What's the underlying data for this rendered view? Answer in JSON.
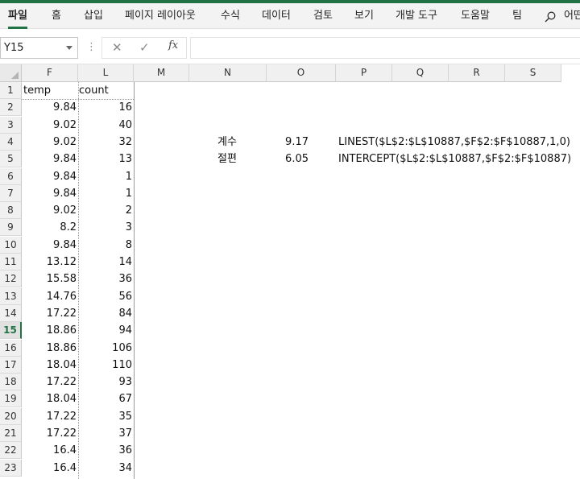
{
  "ribbon": {
    "tabs": [
      "파일",
      "홈",
      "삽입",
      "페이지 레이아웃",
      "수식",
      "데이터",
      "검토",
      "보기",
      "개발 도구",
      "도움말",
      "팀"
    ],
    "active_tab": "파일",
    "overflow_label": "어떤",
    "accent": "#217346"
  },
  "formula_bar": {
    "name_box": "Y15",
    "cancel_glyph": "✕",
    "enter_glyph": "✓",
    "fx_label": "fx",
    "formula": ""
  },
  "grid": {
    "columns": [
      "F",
      "L",
      "M",
      "N",
      "O",
      "P",
      "Q",
      "R",
      "S"
    ],
    "row_numbers": [
      "1",
      "2",
      "3",
      "4",
      "5",
      "6",
      "7",
      "8",
      "9",
      "10",
      "11",
      "12",
      "13",
      "14",
      "15",
      "16",
      "17",
      "18",
      "19",
      "20",
      "21",
      "22",
      "23"
    ],
    "selected_row": "15",
    "headers": {
      "temp": "temp",
      "count": "count"
    },
    "temp": [
      "9.84",
      "9.02",
      "9.02",
      "9.84",
      "9.84",
      "9.84",
      "9.02",
      "8.2",
      "9.84",
      "13.12",
      "15.58",
      "14.76",
      "17.22",
      "18.86",
      "18.86",
      "18.04",
      "17.22",
      "18.04",
      "17.22",
      "17.22",
      "16.4",
      "16.4"
    ],
    "count": [
      "16",
      "40",
      "32",
      "13",
      "1",
      "1",
      "2",
      "3",
      "8",
      "14",
      "36",
      "56",
      "84",
      "94",
      "106",
      "110",
      "93",
      "67",
      "35",
      "37",
      "36",
      "34"
    ],
    "coef_label": "계수",
    "coef_value": "9.17",
    "coef_formula": "LINEST($L$2:$L$10887,$F$2:$F$10887,1,0)",
    "intercept_label": "절편",
    "intercept_value": "6.05",
    "intercept_formula": "INTERCEPT($L$2:$L$10887,$F$2:$F$10887)"
  }
}
